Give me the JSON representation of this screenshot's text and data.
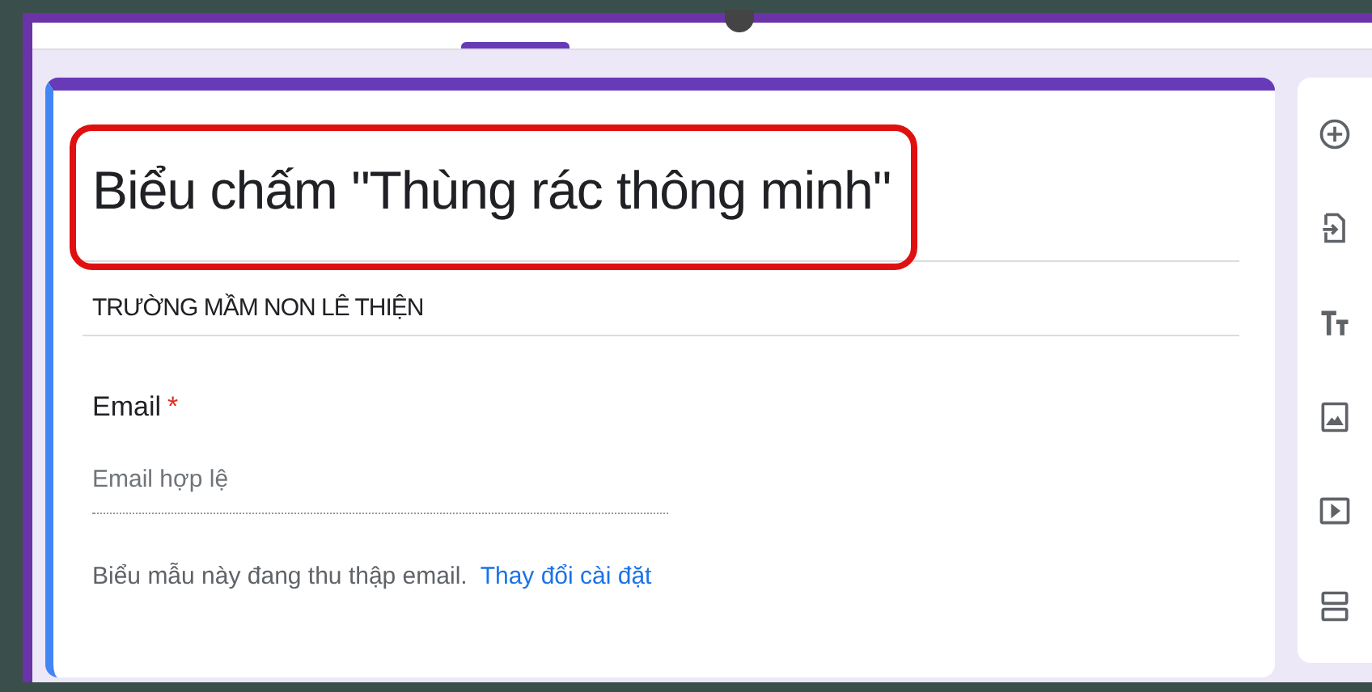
{
  "form": {
    "title": "Biểu chấm \"Thùng rác thông minh\"",
    "subtitle": "TRƯỜNG MẦM NON LÊ THIỆN",
    "question": {
      "label": "Email",
      "required": true,
      "required_mark": "*",
      "placeholder": "Email hợp lệ"
    },
    "notice": "Biểu mẫu này đang thu thập email.",
    "notice_link": "Thay đổi cài đặt"
  },
  "toolbar": [
    {
      "kind": "add"
    },
    {
      "kind": "import"
    },
    {
      "kind": "title"
    },
    {
      "kind": "image"
    },
    {
      "kind": "video"
    },
    {
      "kind": "section"
    }
  ]
}
